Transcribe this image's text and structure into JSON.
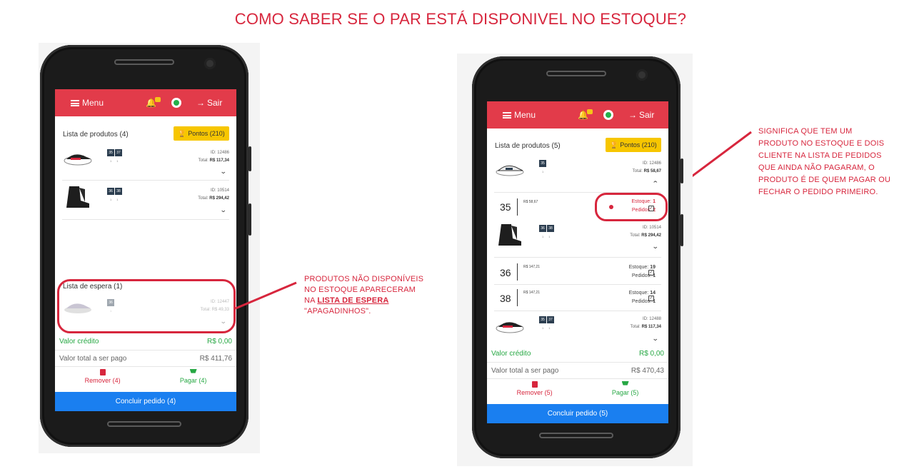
{
  "heading": "COMO SABER SE O PAR ESTÁ DISPONIVEL NO ESTOQUE?",
  "colors": {
    "accent": "#e23b4a",
    "annotation": "#d7263d",
    "green": "#27a844",
    "blue": "#1a7ff0",
    "pontos": "#f7c600"
  },
  "topbar": {
    "menu": "Menu",
    "logout": "Sair",
    "icons": [
      "menu-icon",
      "bell-icon",
      "whatsapp-icon",
      "logout-icon"
    ]
  },
  "left": {
    "list_title": "Lista de produtos (4)",
    "pontos": "Pontos (210)",
    "products": [
      {
        "sizes": [
          "35",
          "37"
        ],
        "qty": [
          "1",
          "1"
        ],
        "id": "ID: 12486",
        "total_label": "Total:",
        "total": "R$ 117,34"
      },
      {
        "sizes": [
          "36",
          "38"
        ],
        "qty": [
          "1",
          "1"
        ],
        "id": "ID: 10514",
        "total_label": "Total:",
        "total": "R$ 294,42"
      }
    ],
    "wait_title": "Lista de espera (1)",
    "waiting": {
      "sizes": [
        "36"
      ],
      "qty": [
        "1"
      ],
      "id": "ID: 12447",
      "total": "Total: R$ 49,33"
    },
    "credit_label": "Valor crédito",
    "credit_value": "R$ 0,00",
    "total_label": "Valor total a ser pago",
    "total_value": "R$ 411,76",
    "remove": "Remover (4)",
    "pay": "Pagar (4)",
    "conclude": "Concluir pedido (4)"
  },
  "right": {
    "list_title": "Lista de produtos (5)",
    "pontos": "Pontos (210)",
    "product1": {
      "sizes": [
        "35"
      ],
      "qty": [
        "1"
      ],
      "id": "ID: 12486",
      "total_label": "Total:",
      "total": "R$ 58,67"
    },
    "detail1": {
      "size": "35",
      "price": "R$ 58,67",
      "stock_label": "Estoque:",
      "stock": "1",
      "orders_label": "Pedidos:",
      "orders": "2"
    },
    "product2": {
      "sizes": [
        "36",
        "38"
      ],
      "qty": [
        "1",
        "1"
      ],
      "id": "ID: 10514",
      "total_label": "Total:",
      "total": "R$ 294,42"
    },
    "detail2": {
      "size": "36",
      "price": "R$ 147,21",
      "stock_label": "Estoque:",
      "stock": "19",
      "orders_label": "Pedidos:",
      "orders": "1"
    },
    "detail3": {
      "size": "38",
      "price": "R$ 147,21",
      "stock_label": "Estoque:",
      "stock": "14",
      "orders_label": "Pedidos:",
      "orders": "1"
    },
    "product3": {
      "sizes": [
        "35",
        "37"
      ],
      "qty": [
        "1",
        "1"
      ],
      "id": "ID: 12488",
      "total_label": "Total:",
      "total": "R$ 117,34"
    },
    "credit_label": "Valor crédito",
    "credit_value": "R$ 0,00",
    "total_label": "Valor total a ser pago",
    "total_value": "R$ 470,43",
    "remove": "Remover (5)",
    "pay": "Pagar (5)",
    "conclude": "Concluir pedido (5)"
  },
  "annotation_left": {
    "line1": "PRODUTOS NÃO DISPONÍVEIS",
    "line2": "NO ESTOQUE APARECERAM",
    "line3_prefix": "NA ",
    "line3_link": "LISTA DE ESPERA",
    "line4": "\"APAGADINHOS\"."
  },
  "annotation_right": {
    "line1": "SIGNIFICA QUE TEM UM",
    "line2": "PRODUTO NO ESTOQUE E DOIS",
    "line3": "CLIENTE NA LISTA DE PEDIDOS",
    "line4": "QUE AINDA NÃO PAGARAM, O",
    "line5": "PRODUTO É DE QUEM PAGAR OU",
    "line6": "FECHAR O PEDIDO PRIMEIRO."
  }
}
